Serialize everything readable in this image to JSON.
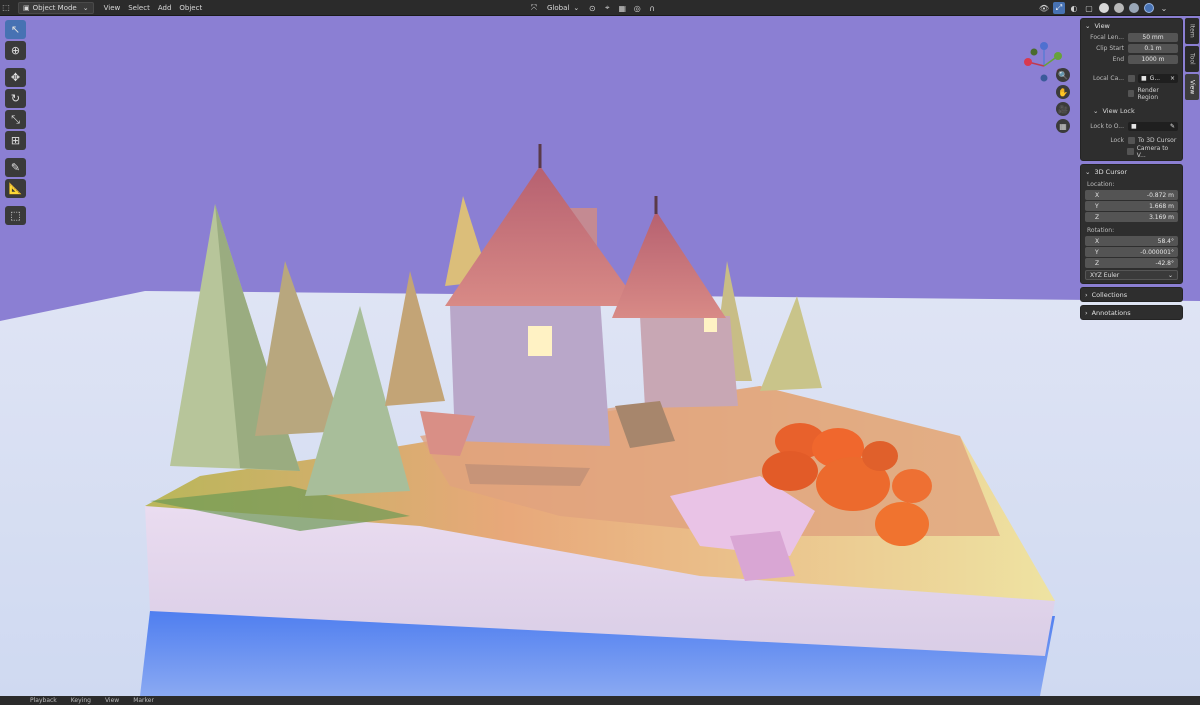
{
  "header": {
    "mode": "Object Mode",
    "menus": [
      "View",
      "Select",
      "Add",
      "Object"
    ],
    "orientation": "Global"
  },
  "npanel": {
    "view": {
      "title": "View",
      "focal_label": "Focal Len...",
      "focal_value": "50 mm",
      "clip_start_label": "Clip Start",
      "clip_start_value": "0.1 m",
      "end_label": "End",
      "end_value": "1000 m",
      "local_camera_label": "Local Ca...",
      "local_camera_value": "G...",
      "render_region_label": "Render Region",
      "view_lock_title": "View Lock",
      "lock_to_label": "Lock to O...",
      "lock_label": "Lock",
      "to_3d_cursor_label": "To 3D Cursor",
      "camera_to_view_label": "Camera to V..."
    },
    "cursor": {
      "title": "3D Cursor",
      "location_label": "Location:",
      "loc_x_label": "X",
      "loc_x": "-0.872 m",
      "loc_y_label": "Y",
      "loc_y": "1.668 m",
      "loc_z_label": "Z",
      "loc_z": "3.169 m",
      "rotation_label": "Rotation:",
      "rot_x_label": "X",
      "rot_x": "58.4°",
      "rot_y_label": "Y",
      "rot_y": "-0.000001°",
      "rot_z_label": "Z",
      "rot_z": "-42.8°",
      "rotation_mode": "XYZ Euler"
    },
    "collections_title": "Collections",
    "annotations_title": "Annotations"
  },
  "sidetabs": [
    "Item",
    "Tool",
    "View"
  ],
  "timeline": {
    "items": [
      "Playback",
      "Keying",
      "View",
      "Marker"
    ]
  },
  "colors": {
    "accent": "#4772b3",
    "sky": "#8b7fd3"
  }
}
